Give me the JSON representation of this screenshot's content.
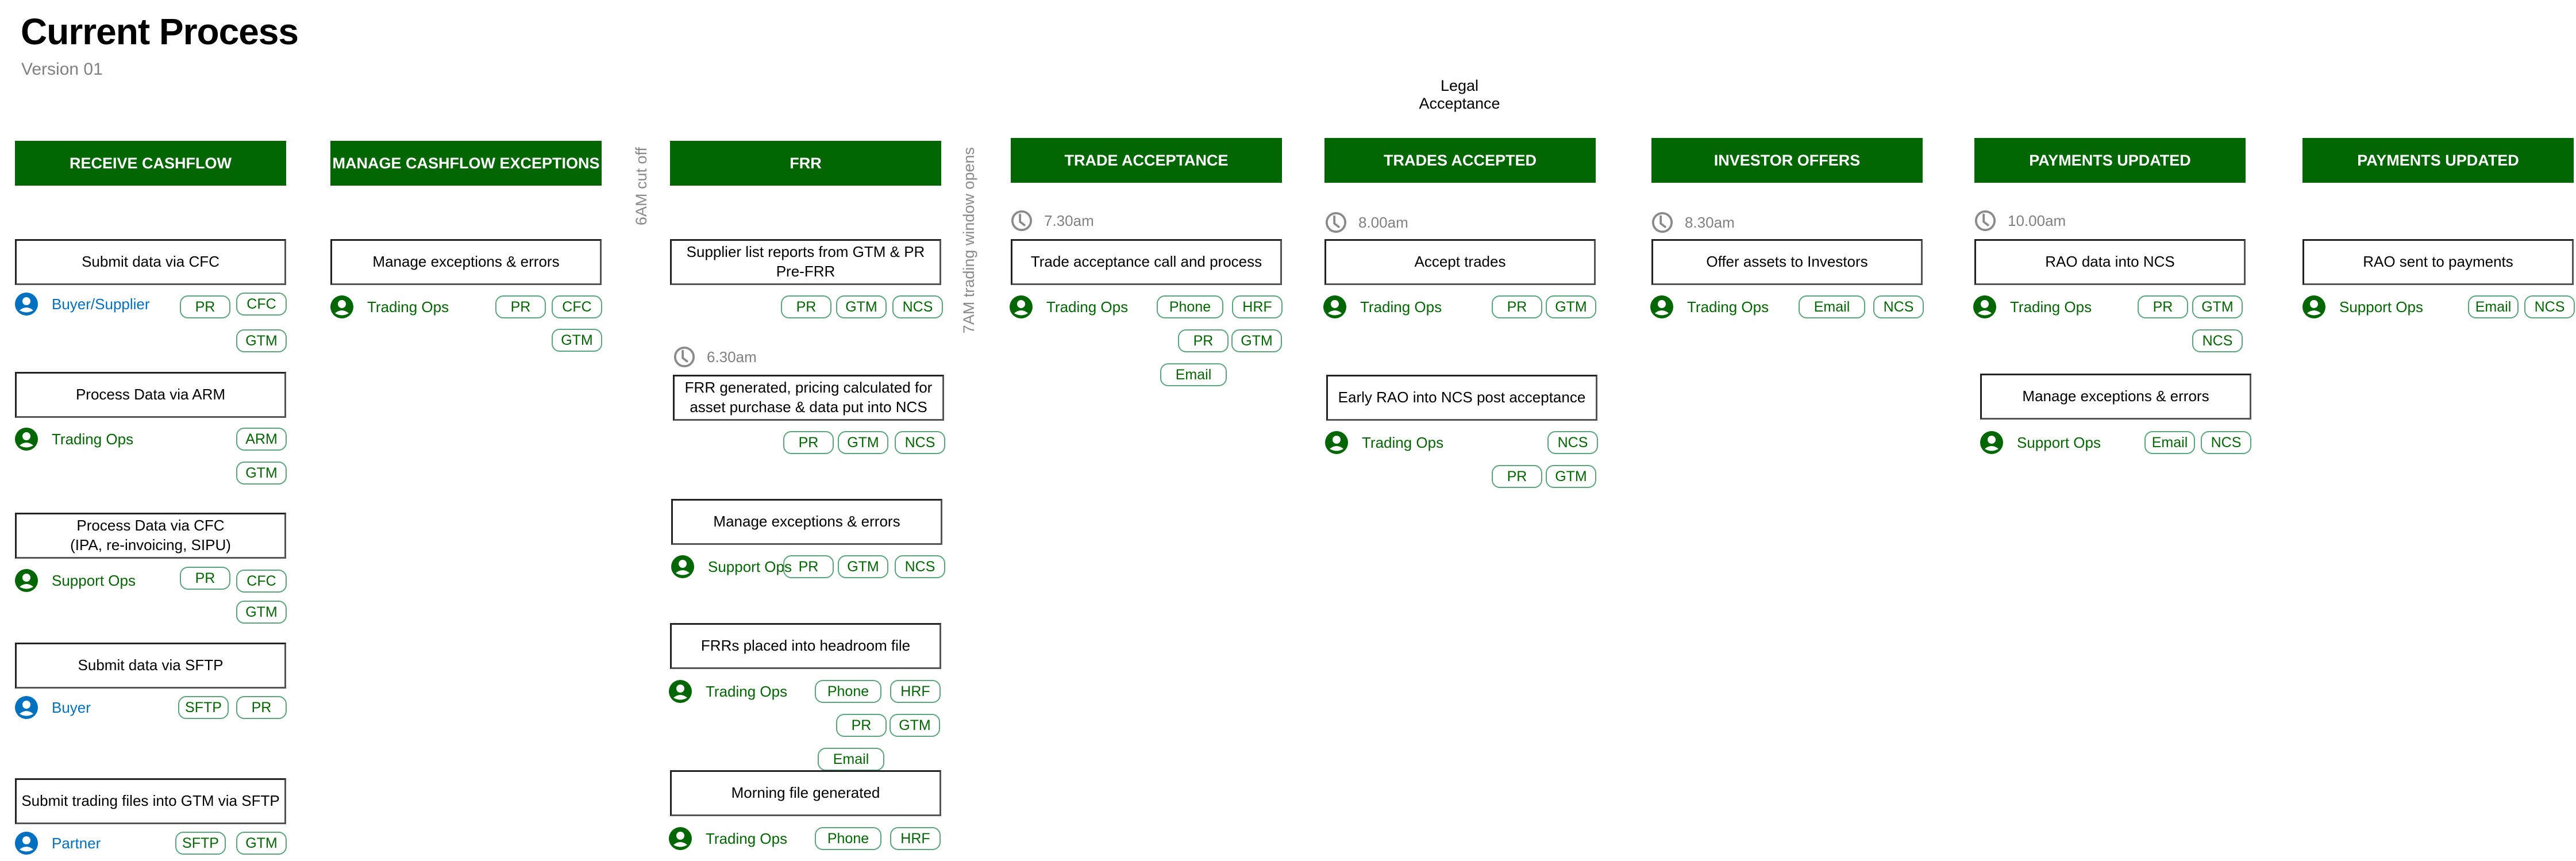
{
  "page": {
    "title": "Current Process",
    "version": "Version 01",
    "legal_acceptance": "Legal Acceptance",
    "markers": {
      "cutoff_6am": "6AM cut off",
      "trading_7am": "7AM trading window opens"
    }
  },
  "colors": {
    "header_green": "#026602",
    "actor_green": "#026602",
    "actor_blue": "#0070c0",
    "tag_border": "#5aa57a",
    "time_gray": "#808080"
  },
  "icons": {
    "person": "person-icon",
    "clock": "clock-icon"
  },
  "columns": [
    {
      "header": "RECEIVE CASHFLOW",
      "steps": [
        {
          "text": "Submit data via CFC",
          "actor": "Buyer/Supplier",
          "actor_color": "blue",
          "tags": [
            "PR",
            "CFC",
            "GTM"
          ]
        },
        {
          "text": "Process Data via ARM",
          "actor": "Trading Ops",
          "actor_color": "green",
          "tags": [
            "ARM",
            "GTM"
          ]
        },
        {
          "text": "Process Data via CFC\n(IPA, re-invoicing, SIPU)",
          "line1": "Process Data via CFC",
          "line2": "(IPA, re-invoicing, SIPU)",
          "actor": "Support Ops",
          "actor_color": "green",
          "tags": [
            "PR",
            "CFC",
            "GTM"
          ]
        },
        {
          "text": "Submit data via SFTP",
          "actor": "Buyer",
          "actor_color": "blue",
          "tags": [
            "SFTP",
            "PR"
          ]
        },
        {
          "text": "Submit trading files into GTM via SFTP",
          "actor": "Partner",
          "actor_color": "blue",
          "tags": [
            "SFTP",
            "GTM"
          ]
        }
      ]
    },
    {
      "header": "MANAGE CASHFLOW EXCEPTIONS",
      "steps": [
        {
          "text": "Manage exceptions & errors",
          "actor": "Trading Ops",
          "actor_color": "green",
          "tags": [
            "PR",
            "CFC",
            "GTM"
          ]
        }
      ]
    },
    {
      "header": "FRR",
      "steps": [
        {
          "line1": "Supplier list reports from GTM & PR",
          "line2": "Pre-FRR",
          "tags": [
            "PR",
            "GTM",
            "NCS"
          ]
        },
        {
          "time": "6.30am",
          "line1": "FRR generated, pricing calculated for",
          "line2": "asset purchase & data put into NCS",
          "tags": [
            "PR",
            "GTM",
            "NCS"
          ]
        },
        {
          "text": "Manage exceptions & errors",
          "actor": "Support Ops",
          "actor_color": "green",
          "tags": [
            "PR",
            "GTM",
            "NCS"
          ]
        },
        {
          "text": "FRRs placed into headroom file",
          "actor": "Trading Ops",
          "actor_color": "green",
          "tags": [
            "Phone",
            "HRF",
            "PR",
            "GTM",
            "Email"
          ]
        },
        {
          "text": "Morning file generated",
          "actor": "Trading Ops",
          "actor_color": "green",
          "tags": [
            "Phone",
            "HRF"
          ]
        }
      ]
    },
    {
      "header": "TRADE ACCEPTANCE",
      "steps": [
        {
          "time": "7.30am",
          "text": "Trade acceptance call and process",
          "actor": "Trading Ops",
          "actor_color": "green",
          "tags": [
            "Phone",
            "HRF",
            "PR",
            "GTM",
            "Email"
          ]
        }
      ]
    },
    {
      "header": "TRADES ACCEPTED",
      "steps": [
        {
          "time": "8.00am",
          "text": "Accept trades",
          "actor": "Trading Ops",
          "actor_color": "green",
          "tags": [
            "PR",
            "GTM"
          ]
        },
        {
          "text": "Early RAO into NCS post acceptance",
          "actor": "Trading Ops",
          "actor_color": "green",
          "tags": [
            "NCS",
            "PR",
            "GTM"
          ]
        }
      ]
    },
    {
      "header": "INVESTOR OFFERS",
      "steps": [
        {
          "time": "8.30am",
          "text": "Offer assets to Investors",
          "actor": "Trading Ops",
          "actor_color": "green",
          "tags": [
            "Email",
            "NCS"
          ]
        }
      ]
    },
    {
      "header": "PAYMENTS UPDATED",
      "steps": [
        {
          "time": "10.00am",
          "text": "RAO data into NCS",
          "actor": "Trading Ops",
          "actor_color": "green",
          "tags": [
            "PR",
            "GTM",
            "NCS"
          ]
        },
        {
          "text": "Manage exceptions & errors",
          "actor": "Support Ops",
          "actor_color": "green",
          "tags": [
            "Email",
            "NCS"
          ]
        }
      ]
    },
    {
      "header": "PAYMENTS UPDATED",
      "steps": [
        {
          "text": "RAO sent to payments",
          "actor": "Support Ops",
          "actor_color": "green",
          "tags": [
            "Email",
            "NCS"
          ]
        }
      ]
    }
  ]
}
